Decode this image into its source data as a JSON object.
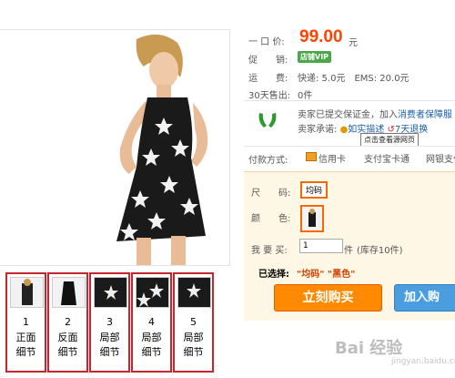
{
  "price_row": {
    "label": "一 口 价:",
    "value": "99.00",
    "unit": "元"
  },
  "promo_row": {
    "label": "促　　销:",
    "badge": "店铺VIP"
  },
  "shipping_row": {
    "label": "运　　费:",
    "text": "快递: 5.0元　EMS: 20.0元"
  },
  "sold_row": {
    "label": "30天售出:",
    "value": "0件"
  },
  "guarantee": {
    "line1_prefix": "卖家已提交保证金，加入",
    "line1_link": "消费者保障服",
    "line2_prefix": "卖家承诺:",
    "link_as_described": "如实描述",
    "link_7day_return": "7天退换",
    "tooltip": "点击查看源网页"
  },
  "payment": {
    "label": "付款方式:",
    "methods": [
      "信用卡",
      "支付宝卡通",
      "网银支付"
    ]
  },
  "options": {
    "size_label": "尺　　码:",
    "size_value": "均码",
    "color_label": "颜　　色:",
    "qty_label": "我 要 买:",
    "qty_value": "1",
    "qty_unit": "件",
    "stock_text": "(库存10件)",
    "selected_label": "已选择:",
    "selected_value": "\"均码\" \"黑色\""
  },
  "buttons": {
    "buy_now": "立刻购买",
    "add_cart": "加入购"
  },
  "thumbnails": [
    {
      "num": "1",
      "line1": "正面",
      "line2": "细节"
    },
    {
      "num": "2",
      "line1": "反面",
      "line2": "细节"
    },
    {
      "num": "3",
      "line1": "局部",
      "line2": "细节"
    },
    {
      "num": "4",
      "line1": "局部",
      "line2": "细节"
    },
    {
      "num": "5",
      "line1": "局部",
      "line2": "细节"
    }
  ],
  "watermark": {
    "brand": "Bai 经验",
    "url": "jingyan.baidu.com"
  }
}
